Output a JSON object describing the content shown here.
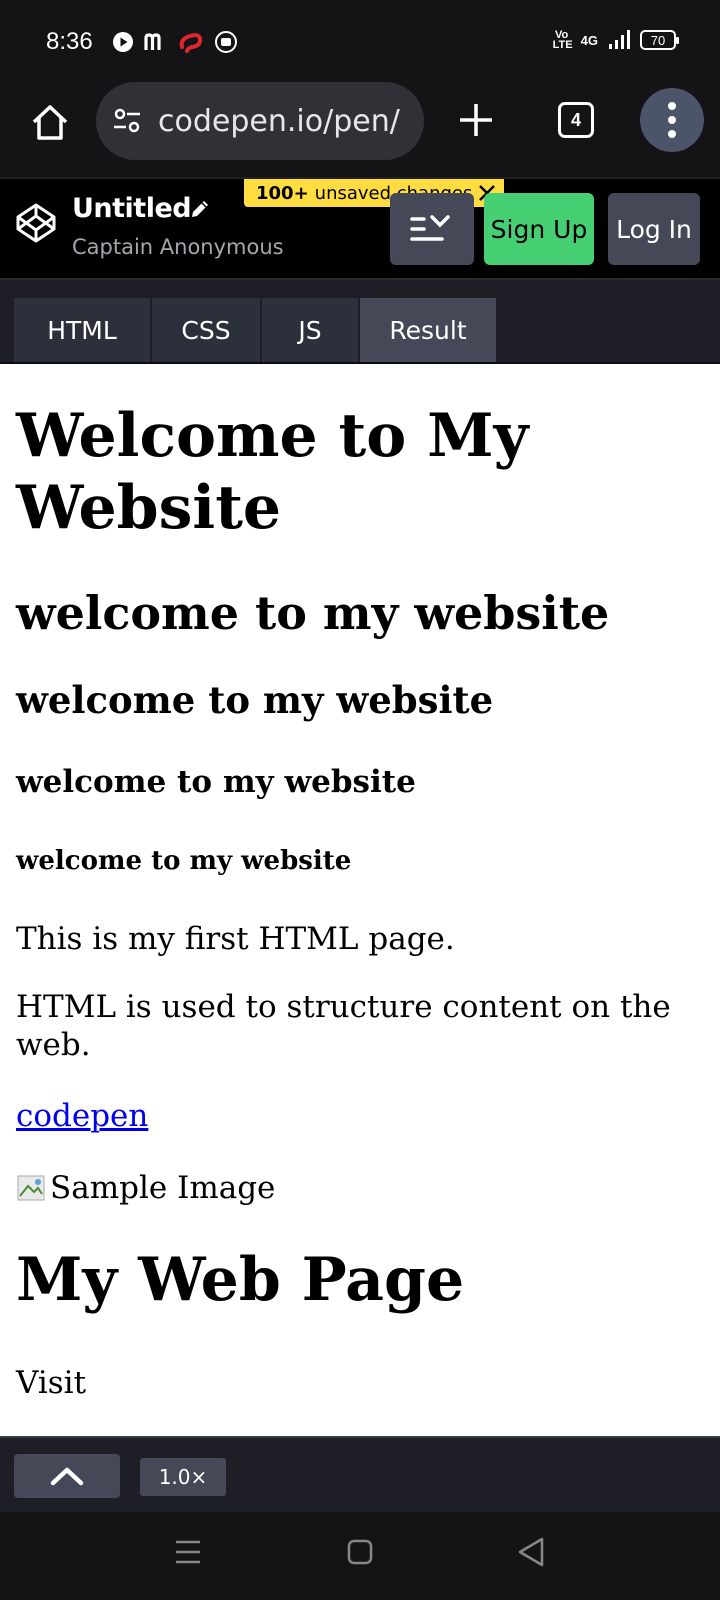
{
  "status_bar": {
    "time": "8:36",
    "network": "4G",
    "volte": "Vo LTE",
    "battery": "70"
  },
  "browser": {
    "url": "codepen.io/pen/",
    "tab_count": "4"
  },
  "codepen": {
    "title": "Untitled",
    "author": "Captain Anonymous",
    "unsaved_count": "100+",
    "unsaved_label": "unsaved changes",
    "signup_label": "Sign Up",
    "login_label": "Log In",
    "colors": {
      "signup": "#47cf73",
      "banner": "#ffdd40",
      "button": "#444857"
    }
  },
  "tabs": [
    {
      "label": "HTML"
    },
    {
      "label": "CSS"
    },
    {
      "label": "JS"
    },
    {
      "label": "Result"
    }
  ],
  "result": {
    "h1": "Welcome to My Website",
    "h2": "welcome to my website",
    "h3": "welcome to my website",
    "h4": "welcome to my website",
    "h5": "welcome to my website",
    "p1": "This is my first HTML page.",
    "p2": "HTML is used to structure content on the web.",
    "link": "codepen",
    "image_alt": "Sample Image",
    "h1b": "My Web Page",
    "p3": "Visit"
  },
  "bottom_bar": {
    "zoom": "1.0×"
  }
}
